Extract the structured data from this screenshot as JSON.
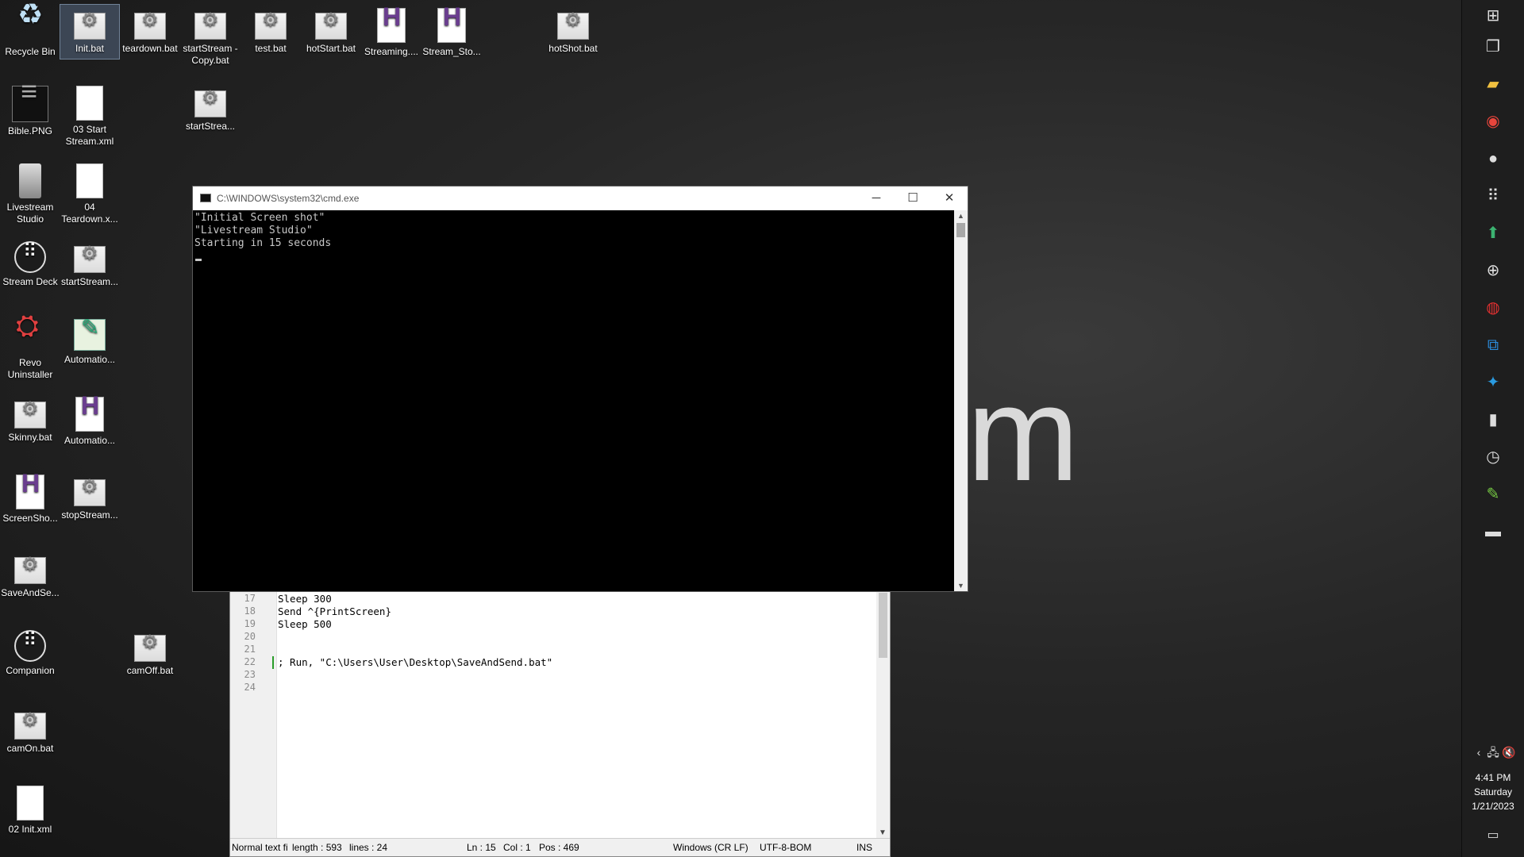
{
  "desktop": {
    "icons": [
      {
        "label": "Recycle Bin",
        "icon": "recycle-bin-icon"
      },
      {
        "label": "Init.bat",
        "icon": "batch-file-icon"
      },
      {
        "label": "teardown.bat",
        "icon": "batch-file-icon"
      },
      {
        "label": "startStream - Copy.bat",
        "icon": "batch-file-icon"
      },
      {
        "label": "test.bat",
        "icon": "batch-file-icon"
      },
      {
        "label": "hotStart.bat",
        "icon": "batch-file-icon"
      },
      {
        "label": "Streaming....",
        "icon": "autohotkey-script-icon"
      },
      {
        "label": "Stream_Sto...",
        "icon": "autohotkey-script-icon"
      },
      {
        "label": "hotShot.bat",
        "icon": "batch-file-icon"
      },
      {
        "label": "Bible.PNG",
        "icon": "image-file-icon"
      },
      {
        "label": "03 Start Stream.xml",
        "icon": "document-icon"
      },
      {
        "label": "startStrea...",
        "icon": "batch-file-icon"
      },
      {
        "label": "Livestream Studio",
        "icon": "livestream-studio-icon"
      },
      {
        "label": "04 Teardown.x...",
        "icon": "document-icon"
      },
      {
        "label": "Stream Deck",
        "icon": "stream-deck-icon"
      },
      {
        "label": "startStream...",
        "icon": "batch-file-icon"
      },
      {
        "label": "Revo Uninstaller",
        "icon": "revo-uninstaller-icon"
      },
      {
        "label": "Automatio...",
        "icon": "automation-icon"
      },
      {
        "label": "Skinny.bat",
        "icon": "batch-file-icon"
      },
      {
        "label": "Automatio...",
        "icon": "autohotkey-script-icon"
      },
      {
        "label": "ScreenSho...",
        "icon": "autohotkey-script-icon"
      },
      {
        "label": "stopStream...",
        "icon": "batch-file-icon"
      },
      {
        "label": "SaveAndSe...",
        "icon": "batch-file-icon"
      },
      {
        "label": "Companion",
        "icon": "companion-icon"
      },
      {
        "label": "camOff.bat",
        "icon": "batch-file-icon"
      },
      {
        "label": "camOn.bat",
        "icon": "batch-file-icon"
      },
      {
        "label": "02 Init.xml",
        "icon": "document-icon"
      }
    ],
    "background_text": "m"
  },
  "cmd_window": {
    "title": "C:\\WINDOWS\\system32\\cmd.exe",
    "lines": [
      "\"Initial Screen shot\"",
      "\"Livestream Studio\"",
      "Starting in 15 seconds"
    ],
    "buttons": {
      "minimize": "─",
      "maximize": "☐",
      "close": "✕"
    }
  },
  "editor": {
    "line_numbers": [
      "17",
      "18",
      "19",
      "20",
      "21",
      "22",
      "23",
      "24"
    ],
    "code_lines": [
      "Sleep 300",
      "Send ^{PrintScreen}",
      "Sleep 500",
      "",
      "",
      "; Run, \"C:\\Users\\User\\Desktop\\SaveAndSend.bat\"",
      "",
      ""
    ],
    "status": {
      "type": "Normal text fi",
      "length": "length : 593",
      "lines": "lines : 24",
      "ln": "Ln : 15",
      "col": "Col : 1",
      "pos": "Pos : 469",
      "eol": "Windows (CR LF)",
      "encoding": "UTF-8-BOM",
      "mode": "INS"
    }
  },
  "taskbar": {
    "time": "4:41 PM",
    "day": "Saturday",
    "date": "1/21/2023",
    "pinned": [
      "windows-start-icon",
      "task-view-icon",
      "file-explorer-icon",
      "chrome-icon",
      "obs-icon",
      "stream-deck-icon",
      "green-upload-icon",
      "network-globe-icon",
      "red-app-icon",
      "vscode-icon",
      "bitfocus-icon",
      "livestream-studio-icon",
      "clock-app-icon",
      "automation-icon",
      "terminal-icon"
    ],
    "tray": [
      "chevron-left-icon",
      "network-icon",
      "volume-muted-icon"
    ],
    "notification": "notification-icon"
  },
  "colors": {
    "desktop_bg": "#262626",
    "cmd_bg": "#000000",
    "cmd_text": "#c8c8c8",
    "accent_green": "#2a9d2a"
  }
}
